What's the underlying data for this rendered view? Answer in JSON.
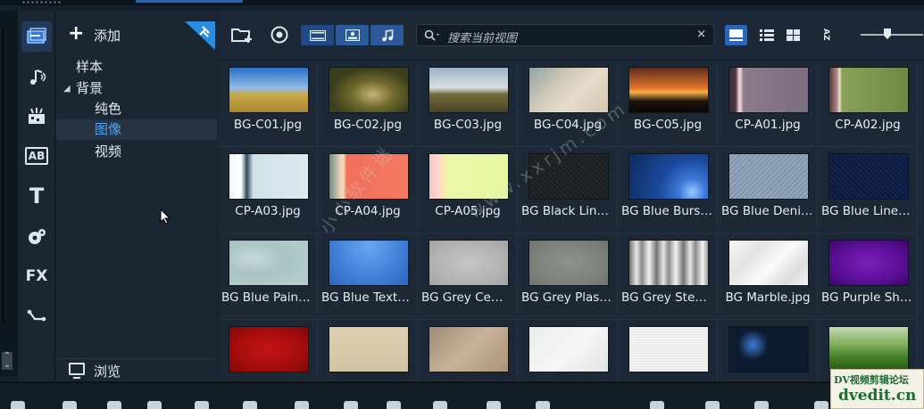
{
  "sidebar_tools": [
    {
      "name": "media-icon"
    },
    {
      "name": "audio-icon"
    },
    {
      "name": "transition-icon"
    },
    {
      "name": "title-icon",
      "label": "AB"
    },
    {
      "name": "text-icon",
      "label": "T"
    },
    {
      "name": "graphics-icon"
    },
    {
      "name": "filter-icon",
      "label": "FX"
    },
    {
      "name": "path-icon"
    }
  ],
  "tree": {
    "add_label": "添加",
    "items": [
      {
        "label": "样本",
        "level": 0,
        "selected": false,
        "expanded": null
      },
      {
        "label": "背景",
        "level": 0,
        "selected": false,
        "expanded": true
      },
      {
        "label": "纯色",
        "level": 1,
        "selected": false,
        "expanded": null
      },
      {
        "label": "图像",
        "level": 1,
        "selected": true,
        "expanded": null
      },
      {
        "label": "视频",
        "level": 1,
        "selected": false,
        "expanded": null
      }
    ],
    "browse_label": "浏览"
  },
  "toolbar": {
    "search_placeholder": "搜索当前视图",
    "clear": "×",
    "sort_label": "AZ"
  },
  "items": [
    {
      "label": "BG-C01.jpg",
      "bg": "linear-gradient(180deg,#2a6fc9 0%,#8fbce8 45%,#c9a84a 60%,#a8862f 100%)"
    },
    {
      "label": "BG-C02.jpg",
      "bg": "radial-gradient(ellipse at 55% 60%,#c7b27a 0%,#6f6a2c 35%,#3b3e1d 70%),linear-gradient(180deg,#9fa8a0,#545a2a)"
    },
    {
      "label": "BG-C03.jpg",
      "bg": "linear-gradient(180deg,#9cb3c9 0%,#d8dfe3 45%,#6f6b3c 60%,#4a4328 100%)"
    },
    {
      "label": "BG-C04.jpg",
      "bg": "linear-gradient(135deg,#8fa3a8 0%,#cfc7b5 35%,#e6dccb 60%,#d4c6ae 100%)"
    },
    {
      "label": "BG-C05.jpg",
      "bg": "linear-gradient(180deg,#5b2d1e 0%,#e0742a 45%,#f4b046 55%,#1d120d 75%,#0c0806 100%)"
    },
    {
      "label": "CP-A01.jpg",
      "bg": "linear-gradient(90deg,#3a2c36 0%,#4a3644 8%,#e8c7cf 12%,#f2d3d8 14%,#8d7b8a 18%,#7b6d7e 100%)"
    },
    {
      "label": "CP-A02.jpg",
      "bg": "linear-gradient(90deg,#4b3a3e 0%,#b98b8b 10%,#efe4d0 13%,#8ba05a 16%,#6c8a43 100%)"
    },
    {
      "label": "CP-A03.jpg",
      "bg": "linear-gradient(90deg,#f3f7f7 0%,#ffffff 15%,#2f4a5c 22%,#cfe2e8 30%,#dbeaef 100%)"
    },
    {
      "label": "CP-A04.jpg",
      "bg": "linear-gradient(90deg,#6c8b86 0%,#e8d2b8 14%,#f0d8b4 18%,#f06f5a 22%,#f47a61 100%)"
    },
    {
      "label": "CP-A05.jpg",
      "bg": "linear-gradient(90deg,#f5c7c6 0%,#ffd6d2 12%,#fde7b3 18%,#ecf7a6 24%,#e6f7a2 100%)"
    },
    {
      "label": "BG Black Linen.jpg",
      "bg": "repeating-linear-gradient(45deg,#1b1d1f 0,#1b1d1f 2px,#242729 2px,#242729 4px)"
    },
    {
      "label": "BG Blue Burst.jpg",
      "bg": "radial-gradient(circle at 80% 85%,#9cc8ff 0%,#3d79d6 18%,#1a4a9c 45%,#0e2a5f 100%)"
    },
    {
      "label": "BG Blue Denim.jpg",
      "bg": "repeating-linear-gradient(135deg,#7f93ab 0,#7f93ab 2px,#96a8bd 2px,#96a8bd 4px)"
    },
    {
      "label": "BG Blue Linen.jpg",
      "bg": "repeating-linear-gradient(45deg,#0d1a3d 0,#0d1a3d 2px,#13244f 2px,#13244f 4px)"
    },
    {
      "label": "BG Blue Paint.jpg",
      "bg": "radial-gradient(ellipse at 30% 40%,#c7d9d8 0%,#a9c3c4 40%,#b8cfcf 100%)"
    },
    {
      "label": "BG Blue Texture.jpg",
      "bg": "radial-gradient(ellipse at 50% 10%,#6aa7f2 0%,#3f7fd6 60%,#2d66bb 100%)"
    },
    {
      "label": "BG Grey Cement.jpg",
      "bg": "radial-gradient(ellipse at 50% 50%,#c6c6c6 0%,#b3b3b3 60%,#a3a3a3 100%)"
    },
    {
      "label": "BG Grey Plaster.jpg",
      "bg": "radial-gradient(ellipse at 50% 50%,#8d938c 0%,#7a8078 70%,#6d726b 100%)"
    },
    {
      "label": "BG Grey Steel.jpg",
      "bg": "repeating-linear-gradient(90deg,#6e6e6e 0,#e6e6e6 8px,#8a8a8a 14px,#f2f2f2 22px,#7c7c7c 30px)"
    },
    {
      "label": "BG Marble.jpg",
      "bg": "linear-gradient(135deg,#f6f6f6 0%,#e3e3e3 30%,#fafafa 55%,#dcdcdc 80%,#f2f2f2 100%)"
    },
    {
      "label": "BG Purple Shadow.jpg",
      "bg": "radial-gradient(ellipse at 50% 50%,#7a1fb8 0%,#5b0f96 60%,#3c0668 100%)"
    },
    {
      "label": "",
      "bg": "radial-gradient(ellipse at 50% 50%,#c41414 0%,#a50d0d 60%,#7d0808 100%)"
    },
    {
      "label": "",
      "bg": "linear-gradient(180deg,#ddd0b3 0%,#d3c4a2 100%)"
    },
    {
      "label": "",
      "bg": "linear-gradient(135deg,#9f8a74 0%,#c8b39a 50%,#a99378 100%)"
    },
    {
      "label": "",
      "bg": "linear-gradient(135deg,#e9eaea 0%,#f7f7f7 50%,#e2e3e3 100%)"
    },
    {
      "label": "",
      "bg": "repeating-linear-gradient(0deg,#f3f3f3 0,#f3f3f3 2px,#e6e6e6 2px,#e6e6e6 3px)"
    },
    {
      "label": "",
      "bg": "radial-gradient(circle at 30% 40%,#3d7bd6 0%,#0d1b2f 25%),radial-gradient(circle at 70% 60%,#2a5ea8 0%,#06101c 30%)"
    },
    {
      "label": "",
      "bg": "linear-gradient(180deg,#c4d9b1 0%,#7fae5a 40%,#3f7b22 70%,#2a5a15 100%)"
    }
  ],
  "watermark": {
    "text1": "小小软件迷",
    "text2": "www.xxrjm.com",
    "badge_line1": "DV视频剪辑论坛",
    "badge_line2": "dvedit.cn"
  },
  "colors": {
    "accent": "#2c66b8",
    "panel": "#1b2633",
    "selected_row": "#273444"
  }
}
